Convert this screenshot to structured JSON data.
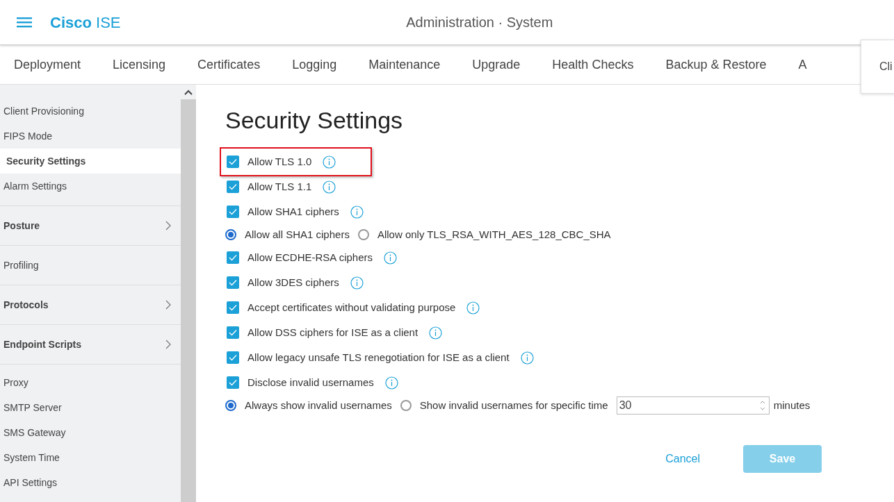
{
  "header": {
    "brand_bold": "Cisco",
    "brand_light": "ISE",
    "title": "Administration · System"
  },
  "tabs": [
    {
      "label": "Deployment",
      "selected": false
    },
    {
      "label": "Licensing",
      "selected": false
    },
    {
      "label": "Certificates",
      "selected": false
    },
    {
      "label": "Logging",
      "selected": false
    },
    {
      "label": "Maintenance",
      "selected": false
    },
    {
      "label": "Upgrade",
      "selected": false
    },
    {
      "label": "Health Checks",
      "selected": false
    },
    {
      "label": "Backup & Restore",
      "selected": false
    },
    {
      "label": "A",
      "selected": false
    }
  ],
  "popup": {
    "text": "Cli"
  },
  "sidebar": {
    "sections": [
      {
        "items": [
          {
            "label": "Client Provisioning",
            "kind": "link",
            "selected": false
          },
          {
            "label": "FIPS Mode",
            "kind": "link",
            "selected": false
          },
          {
            "label": "Security Settings",
            "kind": "link",
            "selected": true
          },
          {
            "label": "Alarm Settings",
            "kind": "link",
            "selected": false
          }
        ]
      },
      {
        "items": [
          {
            "label": "Posture",
            "kind": "group",
            "selected": false
          }
        ]
      },
      {
        "items": [
          {
            "label": "Profiling",
            "kind": "link",
            "selected": false
          }
        ]
      },
      {
        "items": [
          {
            "label": "Protocols",
            "kind": "group",
            "selected": false
          }
        ]
      },
      {
        "items": [
          {
            "label": "Endpoint Scripts",
            "kind": "group",
            "selected": false
          }
        ]
      },
      {
        "items": [
          {
            "label": "Proxy",
            "kind": "link",
            "selected": false
          },
          {
            "label": "SMTP Server",
            "kind": "link",
            "selected": false
          },
          {
            "label": "SMS Gateway",
            "kind": "link",
            "selected": false
          },
          {
            "label": "System Time",
            "kind": "link",
            "selected": false
          },
          {
            "label": "API Settings",
            "kind": "link",
            "selected": false
          }
        ]
      }
    ]
  },
  "page": {
    "title": "Security Settings",
    "rows": [
      {
        "kind": "checkbox",
        "label": "Allow TLS 1.0",
        "checked": true,
        "highlighted": true
      },
      {
        "kind": "checkbox",
        "label": "Allow TLS 1.1",
        "checked": true,
        "highlighted": false
      },
      {
        "kind": "checkbox",
        "label": "Allow SHA1 ciphers",
        "checked": true,
        "highlighted": false
      },
      {
        "kind": "radios",
        "options": [
          {
            "label": "Allow all SHA1 ciphers",
            "selected": true
          },
          {
            "label": "Allow only TLS_RSA_WITH_AES_128_CBC_SHA",
            "selected": false
          }
        ]
      },
      {
        "kind": "checkbox",
        "label": "Allow ECDHE-RSA ciphers",
        "checked": true,
        "highlighted": false
      },
      {
        "kind": "checkbox",
        "label": "Allow 3DES ciphers",
        "checked": true,
        "highlighted": false
      },
      {
        "kind": "checkbox",
        "label": "Accept certificates without validating purpose",
        "checked": true,
        "highlighted": false
      },
      {
        "kind": "checkbox",
        "label": "Allow DSS ciphers for ISE as a client",
        "checked": true,
        "highlighted": false
      },
      {
        "kind": "checkbox",
        "label": "Allow legacy unsafe TLS renegotiation for ISE as a client",
        "checked": true,
        "highlighted": false
      },
      {
        "kind": "checkbox",
        "label": "Disclose invalid usernames",
        "checked": true,
        "highlighted": false
      },
      {
        "kind": "radios",
        "options": [
          {
            "label": "Always show invalid usernames",
            "selected": true
          },
          {
            "label": "Show invalid usernames for specific time",
            "selected": false
          }
        ],
        "input": {
          "value": "30",
          "unit": "minutes"
        }
      }
    ],
    "buttons": [
      {
        "kind": "cancel",
        "label": "Cancel",
        "disabled": false
      },
      {
        "kind": "save",
        "label": "Save",
        "disabled": true
      }
    ]
  }
}
